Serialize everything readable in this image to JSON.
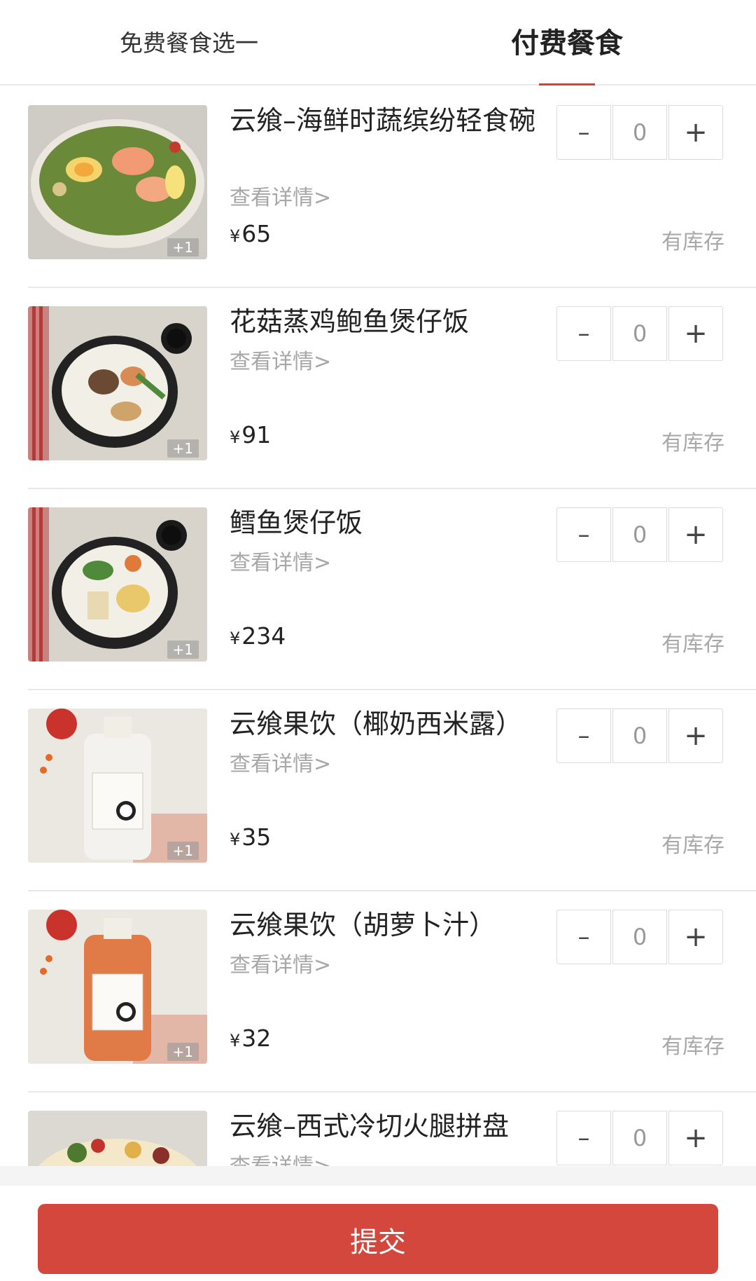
{
  "tabs": {
    "free": "免费餐食选一",
    "paid": "付费餐食"
  },
  "details_label": "查看详情>",
  "stock_label": "有库存",
  "plus_one": "+1",
  "currency": "¥",
  "items": [
    {
      "name": "云飨–海鲜时蔬缤纷轻食碗",
      "price": "65",
      "qty": "0"
    },
    {
      "name": "花菇蒸鸡鲍鱼煲仔饭",
      "price": "91",
      "qty": "0"
    },
    {
      "name": "鳕鱼煲仔饭",
      "price": "234",
      "qty": "0"
    },
    {
      "name": "云飨果饮（椰奶西米露）",
      "price": "35",
      "qty": "0"
    },
    {
      "name": "云飨果饮（胡萝卜汁）",
      "price": "32",
      "qty": "0"
    },
    {
      "name": "云飨–西式冷切火腿拼盘",
      "price": "",
      "qty": "0"
    }
  ],
  "stepper": {
    "minus": "–",
    "plus": "+"
  },
  "submit_label": "提交",
  "colors": {
    "accent": "#d3473c",
    "tab_underline": "#c8443b"
  }
}
